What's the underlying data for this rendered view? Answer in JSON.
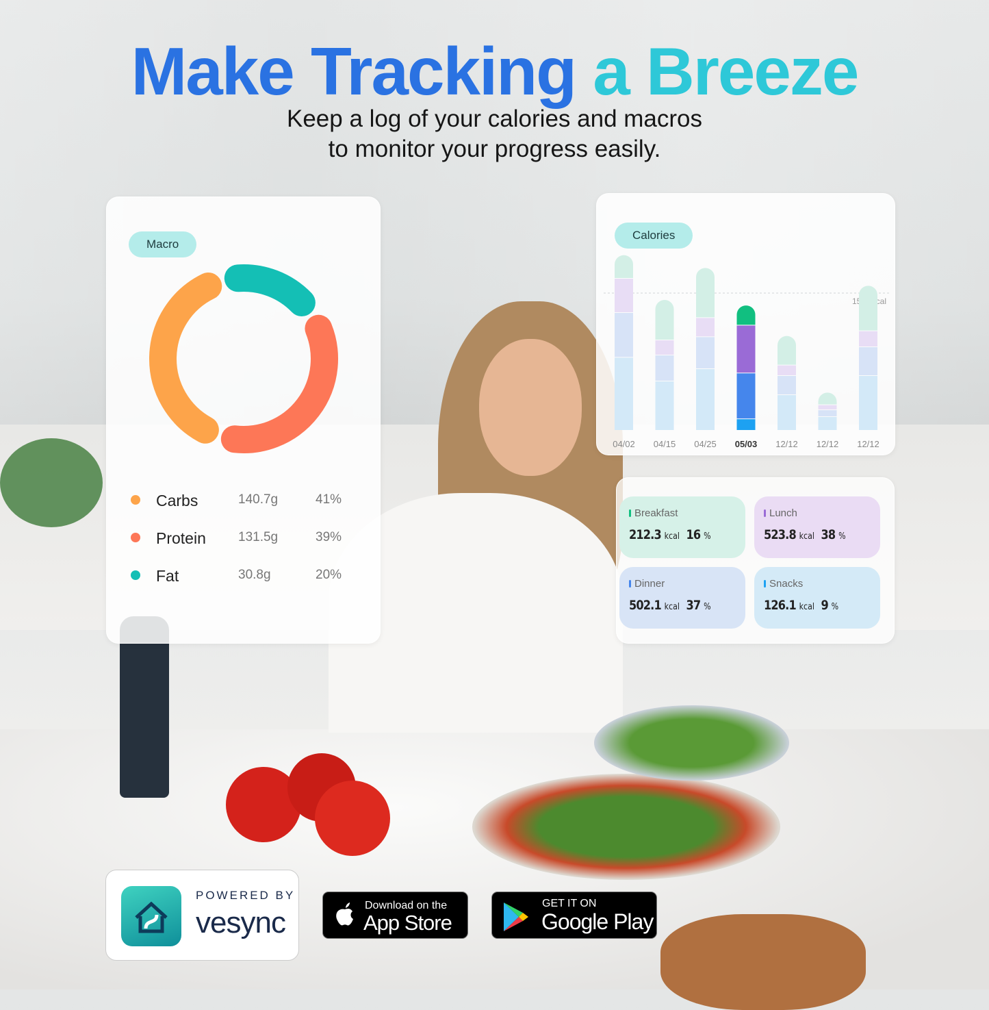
{
  "headline": {
    "part1": "Make Tracking",
    "part2": "a Breeze"
  },
  "subtitle": {
    "line1": "Keep a log of your calories and macros",
    "line2": "to monitor your progress easily."
  },
  "macro_card": {
    "label": "Macro",
    "items": [
      {
        "name": "Carbs",
        "grams": "140.7g",
        "percent": "41%",
        "pct": 41,
        "color": "#fda44a"
      },
      {
        "name": "Protein",
        "grams": "131.5g",
        "percent": "39%",
        "pct": 39,
        "color": "#fd7757"
      },
      {
        "name": "Fat",
        "grams": "30.8g",
        "percent": "20%",
        "pct": 20,
        "color": "#14bfb5"
      }
    ]
  },
  "chart_data": {
    "type": "bar",
    "stacked": true,
    "title": "Calories",
    "categories": [
      "04/02",
      "04/15",
      "04/25",
      "05/03",
      "12/12",
      "12/12",
      "12/12"
    ],
    "highlighted_category": "05/03",
    "reference_line": {
      "value": 1500,
      "label": "1500Kcal"
    },
    "ylim": [
      0,
      2000
    ],
    "series": [
      {
        "color": "#1da1f2",
        "faded_color": "#d3e9f8",
        "values": [
          800,
          540,
          675,
          126.1,
          390,
          150,
          600
        ]
      },
      {
        "color": "#4586ec",
        "faded_color": "#d7e3f7",
        "values": [
          490,
          285,
          350,
          502.1,
          210,
          75,
          315
        ]
      },
      {
        "color": "#9a6bd6",
        "faded_color": "#e8ddf5",
        "values": [
          375,
          165,
          210,
          523.8,
          115,
          55,
          175
        ]
      },
      {
        "color": "#11bf80",
        "faded_color": "#d3efe6",
        "values": [
          250,
          435,
          540,
          212.3,
          315,
          130,
          490
        ]
      }
    ]
  },
  "meals": [
    {
      "name": "Breakfast",
      "kcal": "212.3",
      "unit": "kcal",
      "percent": "16",
      "pct_unit": "%",
      "bg": "#d6f1e8",
      "accent": "#11bf80"
    },
    {
      "name": "Lunch",
      "kcal": "523.8",
      "unit": "kcal",
      "percent": "38",
      "pct_unit": "%",
      "bg": "#eadcf4",
      "accent": "#9a6bd6"
    },
    {
      "name": "Dinner",
      "kcal": "502.1",
      "unit": "kcal",
      "percent": "37",
      "pct_unit": "%",
      "bg": "#d8e4f6",
      "accent": "#4586ec"
    },
    {
      "name": "Snacks",
      "kcal": "126.1",
      "unit": "kcal",
      "percent": "9",
      "pct_unit": "%",
      "bg": "#d4eaf7",
      "accent": "#1da1f2"
    }
  ],
  "footer": {
    "powered_by": "POWERED BY",
    "brand": "vesync",
    "app_store": {
      "small": "Download on the",
      "big": "App Store"
    },
    "google_play": {
      "small": "GET IT ON",
      "big": "Google Play"
    }
  }
}
